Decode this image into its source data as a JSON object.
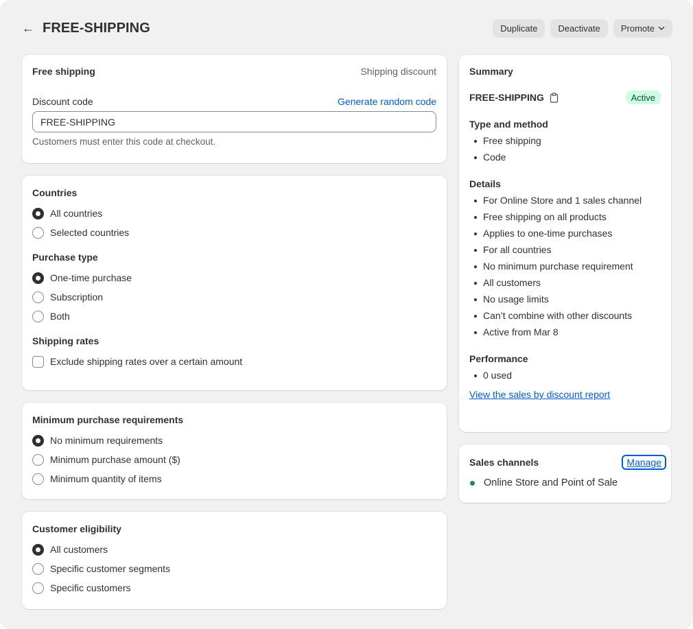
{
  "header": {
    "title": "FREE-SHIPPING",
    "back_glyph": "←",
    "duplicate_label": "Duplicate",
    "deactivate_label": "Deactivate",
    "promote_label": "Promote"
  },
  "code_card": {
    "title": "Free shipping",
    "type": "Shipping discount",
    "code_label": "Discount code",
    "generate_link": "Generate random code",
    "code_value": "FREE-SHIPPING",
    "help_text": "Customers must enter this code at checkout."
  },
  "options_card": {
    "countries_heading": "Countries",
    "countries": [
      "All countries",
      "Selected countries"
    ],
    "countries_selected": 0,
    "purchase_heading": "Purchase type",
    "purchase_types": [
      "One-time purchase",
      "Subscription",
      "Both"
    ],
    "purchase_selected": 0,
    "shipping_heading": "Shipping rates",
    "shipping_checkbox_label": "Exclude shipping rates over a certain amount",
    "shipping_checked": false
  },
  "min_card": {
    "heading": "Minimum purchase requirements",
    "options": [
      "No minimum requirements",
      "Minimum purchase amount ($)",
      "Minimum quantity of items"
    ],
    "selected": 0
  },
  "eligibility_card": {
    "heading": "Customer eligibility",
    "options": [
      "All customers",
      "Specific customer segments",
      "Specific customers"
    ],
    "selected": 0
  },
  "summary": {
    "heading": "Summary",
    "code": "FREE-SHIPPING",
    "status": "Active",
    "type_heading": "Type and method",
    "type_items": [
      "Free shipping",
      "Code"
    ],
    "details_heading": "Details",
    "details_items": [
      "For Online Store and 1 sales channel",
      "Free shipping on all products",
      "Applies to one-time purchases",
      "For all countries",
      "No minimum purchase requirement",
      "All customers",
      "No usage limits",
      "Can’t combine with other discounts",
      "Active from Mar 8"
    ],
    "performance_heading": "Performance",
    "performance_items": [
      "0 used"
    ],
    "report_link": "View the sales by discount report"
  },
  "sales_channels": {
    "heading": "Sales channels",
    "manage_label": "Manage",
    "channel": "Online Store and Point of Sale"
  },
  "colors": {
    "accent": "#005bd3",
    "badge_bg": "#cdfee1",
    "badge_text": "#0c5132",
    "channel_dot": "#29845a",
    "page_bg": "#f1f1f1"
  }
}
